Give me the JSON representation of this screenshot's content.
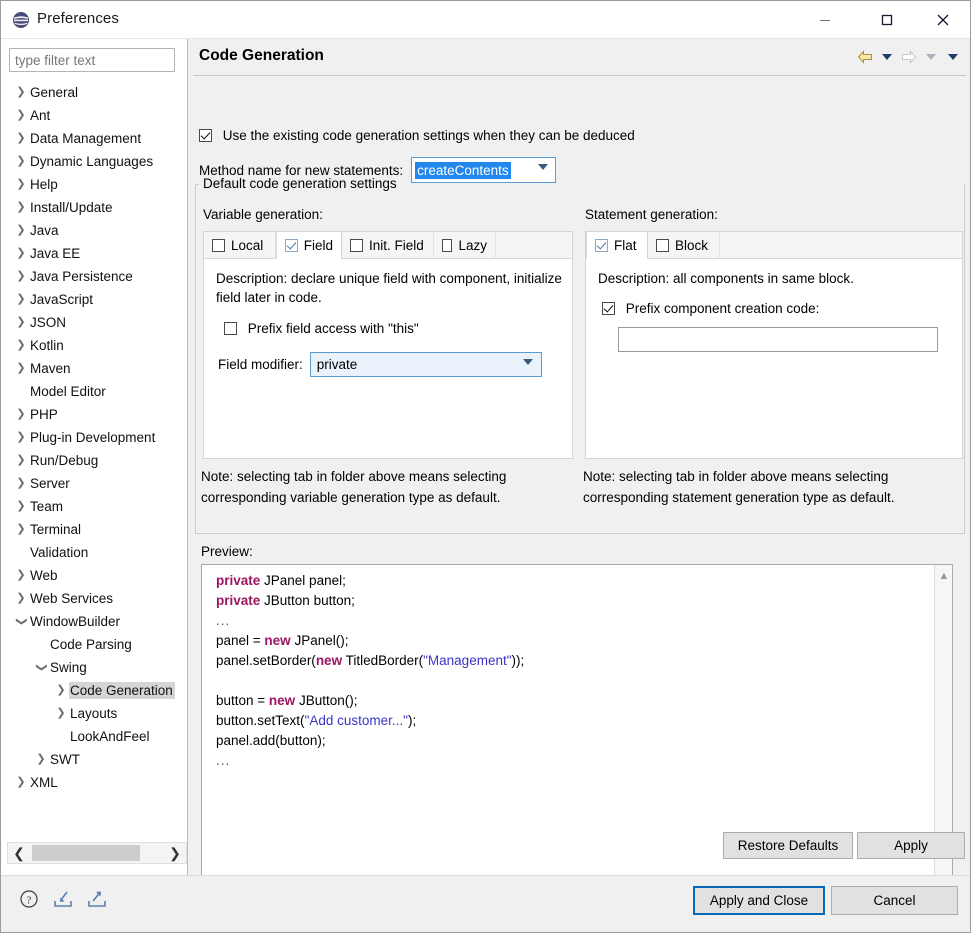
{
  "window": {
    "title": "Preferences",
    "app_icon": "eclipse-icon",
    "controls": {
      "minimize": "minimize-icon",
      "maximize": "maximize-icon",
      "close": "close-icon"
    }
  },
  "sidebar": {
    "filter_placeholder": "type filter text",
    "filter_value": "",
    "items": [
      {
        "label": "General",
        "indent": 0,
        "twisty": "collapsed",
        "selected": false
      },
      {
        "label": "Ant",
        "indent": 0,
        "twisty": "collapsed",
        "selected": false
      },
      {
        "label": "Data Management",
        "indent": 0,
        "twisty": "collapsed",
        "selected": false
      },
      {
        "label": "Dynamic Languages",
        "indent": 0,
        "twisty": "collapsed",
        "selected": false
      },
      {
        "label": "Help",
        "indent": 0,
        "twisty": "collapsed",
        "selected": false
      },
      {
        "label": "Install/Update",
        "indent": 0,
        "twisty": "collapsed",
        "selected": false
      },
      {
        "label": "Java",
        "indent": 0,
        "twisty": "collapsed",
        "selected": false
      },
      {
        "label": "Java EE",
        "indent": 0,
        "twisty": "collapsed",
        "selected": false
      },
      {
        "label": "Java Persistence",
        "indent": 0,
        "twisty": "collapsed",
        "selected": false
      },
      {
        "label": "JavaScript",
        "indent": 0,
        "twisty": "collapsed",
        "selected": false
      },
      {
        "label": "JSON",
        "indent": 0,
        "twisty": "collapsed",
        "selected": false
      },
      {
        "label": "Kotlin",
        "indent": 0,
        "twisty": "collapsed",
        "selected": false
      },
      {
        "label": "Maven",
        "indent": 0,
        "twisty": "collapsed",
        "selected": false
      },
      {
        "label": "Model Editor",
        "indent": 0,
        "twisty": "none",
        "selected": false
      },
      {
        "label": "PHP",
        "indent": 0,
        "twisty": "collapsed",
        "selected": false
      },
      {
        "label": "Plug-in Development",
        "indent": 0,
        "twisty": "collapsed",
        "selected": false
      },
      {
        "label": "Run/Debug",
        "indent": 0,
        "twisty": "collapsed",
        "selected": false
      },
      {
        "label": "Server",
        "indent": 0,
        "twisty": "collapsed",
        "selected": false
      },
      {
        "label": "Team",
        "indent": 0,
        "twisty": "collapsed",
        "selected": false
      },
      {
        "label": "Terminal",
        "indent": 0,
        "twisty": "collapsed",
        "selected": false
      },
      {
        "label": "Validation",
        "indent": 0,
        "twisty": "none",
        "selected": false
      },
      {
        "label": "Web",
        "indent": 0,
        "twisty": "collapsed",
        "selected": false
      },
      {
        "label": "Web Services",
        "indent": 0,
        "twisty": "collapsed",
        "selected": false
      },
      {
        "label": "WindowBuilder",
        "indent": 0,
        "twisty": "expanded",
        "selected": false
      },
      {
        "label": "Code Parsing",
        "indent": 1,
        "twisty": "none",
        "selected": false
      },
      {
        "label": "Swing",
        "indent": 1,
        "twisty": "expanded",
        "selected": false
      },
      {
        "label": "Code Generation",
        "indent": 2,
        "twisty": "collapsed",
        "selected": true
      },
      {
        "label": "Layouts",
        "indent": 2,
        "twisty": "collapsed",
        "selected": false
      },
      {
        "label": "LookAndFeel",
        "indent": 2,
        "twisty": "none",
        "selected": false
      },
      {
        "label": "SWT",
        "indent": 1,
        "twisty": "collapsed",
        "selected": false
      },
      {
        "label": "XML",
        "indent": 0,
        "twisty": "collapsed",
        "selected": false
      }
    ]
  },
  "page": {
    "title": "Code Generation",
    "nav": {
      "back": "back-arrow-icon",
      "back_menu": "back-dropdown-icon",
      "forward": "forward-arrow-icon",
      "forward_menu": "forward-dropdown-icon",
      "view_menu": "view-menu-icon"
    },
    "deduce_checkbox": {
      "label": "Use the existing code generation settings when they can be deduced",
      "checked": true
    },
    "method_name": {
      "label": "Method name for new statements:",
      "value": "createContents",
      "selected": true
    },
    "group_title": "Default code generation settings",
    "variable_generation": {
      "label": "Variable generation:",
      "tabs": [
        {
          "label": "Local",
          "checked": false,
          "active": false
        },
        {
          "label": "Field",
          "checked": true,
          "active": true
        },
        {
          "label": "Init. Field",
          "checked": false,
          "active": false
        },
        {
          "label": "Lazy",
          "checked": false,
          "active": false
        }
      ],
      "description": "Description: declare unique field with component, initialize field later in code.",
      "prefix_this": {
        "label": "Prefix field access with \"this\"",
        "checked": false
      },
      "field_modifier": {
        "label": "Field modifier:",
        "value": "private"
      },
      "note": "Note: selecting tab in folder above means selecting corresponding variable generation type as default."
    },
    "statement_generation": {
      "label": "Statement generation:",
      "tabs": [
        {
          "label": "Flat",
          "checked": true,
          "active": true
        },
        {
          "label": "Block",
          "checked": false,
          "active": false
        }
      ],
      "description": "Description: all components in same block.",
      "prefix_code": {
        "label": "Prefix component creation code:",
        "checked": true
      },
      "prefix_code_input": {
        "value": "",
        "placeholder": ""
      },
      "note": "Note: selecting tab in folder above means selecting corresponding statement generation type as default."
    },
    "preview": {
      "label": "Preview:",
      "lines": [
        [
          {
            "t": "private",
            "c": "kw"
          },
          {
            "t": " JPanel panel;",
            "c": ""
          }
        ],
        [
          {
            "t": "private",
            "c": "kw"
          },
          {
            "t": " JButton button;",
            "c": ""
          }
        ],
        [
          {
            "t": "...",
            "c": "dots"
          }
        ],
        [
          {
            "t": "panel = ",
            "c": ""
          },
          {
            "t": "new",
            "c": "kw"
          },
          {
            "t": " JPanel();",
            "c": ""
          }
        ],
        [
          {
            "t": "panel.setBorder(",
            "c": ""
          },
          {
            "t": "new",
            "c": "kw"
          },
          {
            "t": " TitledBorder(",
            "c": ""
          },
          {
            "t": "\"Management\"",
            "c": "str"
          },
          {
            "t": "));",
            "c": ""
          }
        ],
        [
          {
            "t": "",
            "c": ""
          }
        ],
        [
          {
            "t": "button = ",
            "c": ""
          },
          {
            "t": "new",
            "c": "kw"
          },
          {
            "t": " JButton();",
            "c": ""
          }
        ],
        [
          {
            "t": "button.setText(",
            "c": ""
          },
          {
            "t": "\"Add customer...\"",
            "c": "str"
          },
          {
            "t": ");",
            "c": ""
          }
        ],
        [
          {
            "t": "panel.add(button);",
            "c": ""
          }
        ],
        [
          {
            "t": "...",
            "c": "dots"
          }
        ]
      ]
    }
  },
  "buttons": {
    "restore_defaults": "Restore Defaults",
    "apply": "Apply",
    "apply_and_close": "Apply and Close",
    "cancel": "Cancel"
  },
  "footer_icons": [
    {
      "name": "help-icon"
    },
    {
      "name": "import-icon"
    },
    {
      "name": "export-icon"
    }
  ],
  "colors": {
    "accent": "#0a69b7",
    "selection": "#2288ee",
    "keyword": "#9b1663",
    "string": "#3a35c8",
    "tree_selection": "#d5d5d5"
  }
}
